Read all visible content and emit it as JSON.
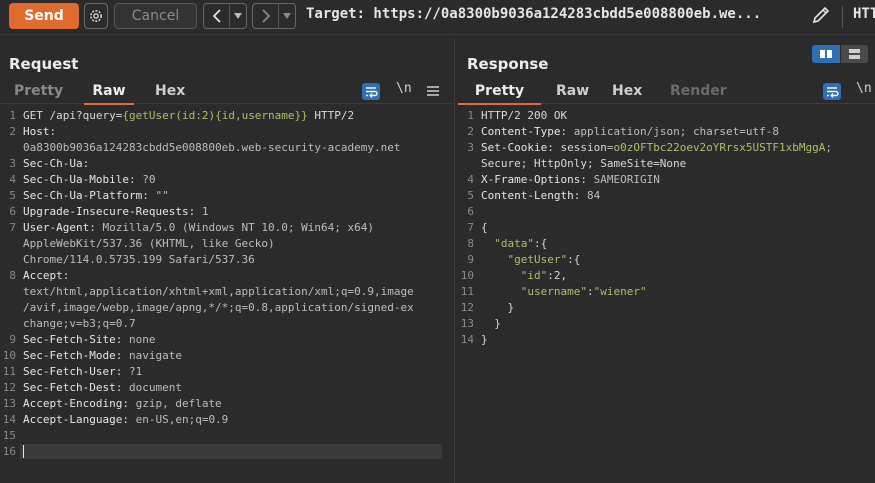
{
  "toolbar": {
    "send_label": "Send",
    "cancel_label": "Cancel",
    "back_label": "<",
    "forward_label": ">",
    "target_text": "Target: https://0a8300b9036a124283cbdd5e008800eb.we...",
    "overflow_text": "HTT"
  },
  "request": {
    "title": "Request",
    "tabs": [
      "Pretty",
      "Raw",
      "Hex"
    ],
    "active_tab": "Raw",
    "newline_toggle": "\\n",
    "lines": [
      {
        "n": "1",
        "text": "GET /api?query={getUser(id:2){id,username}} HTTP/2"
      },
      {
        "n": "2",
        "text": "Host:"
      },
      {
        "n": "",
        "text": "0a8300b9036a124283cbdd5e008800eb.web-security-academy.net"
      },
      {
        "n": "3",
        "text": "Sec-Ch-Ua:"
      },
      {
        "n": "4",
        "text": "Sec-Ch-Ua-Mobile: ?0"
      },
      {
        "n": "5",
        "text": "Sec-Ch-Ua-Platform: \"\""
      },
      {
        "n": "6",
        "text": "Upgrade-Insecure-Requests: 1"
      },
      {
        "n": "7",
        "text": "User-Agent: Mozilla/5.0 (Windows NT 10.0; Win64; x64)"
      },
      {
        "n": "",
        "text": "AppleWebKit/537.36 (KHTML, like Gecko)"
      },
      {
        "n": "",
        "text": "Chrome/114.0.5735.199 Safari/537.36"
      },
      {
        "n": "8",
        "text": "Accept:"
      },
      {
        "n": "",
        "text": "text/html,application/xhtml+xml,application/xml;q=0.9,image"
      },
      {
        "n": "",
        "text": "/avif,image/webp,image/apng,*/*;q=0.8,application/signed-ex"
      },
      {
        "n": "",
        "text": "change;v=b3;q=0.7"
      },
      {
        "n": "9",
        "text": "Sec-Fetch-Site: none"
      },
      {
        "n": "10",
        "text": "Sec-Fetch-Mode: navigate"
      },
      {
        "n": "11",
        "text": "Sec-Fetch-User: ?1"
      },
      {
        "n": "12",
        "text": "Sec-Fetch-Dest: document"
      },
      {
        "n": "13",
        "text": "Accept-Encoding: gzip, deflate"
      },
      {
        "n": "14",
        "text": "Accept-Language: en-US,en;q=0.9"
      },
      {
        "n": "15",
        "text": ""
      },
      {
        "n": "16",
        "text": ""
      }
    ]
  },
  "response": {
    "title": "Response",
    "tabs": [
      "Pretty",
      "Raw",
      "Hex",
      "Render"
    ],
    "active_tab": "Pretty",
    "newline_toggle": "\\n",
    "lines": [
      {
        "n": "1",
        "text": "HTTP/2 200 OK"
      },
      {
        "n": "2",
        "text": "Content-Type: application/json; charset=utf-8"
      },
      {
        "n": "3",
        "text": "Set-Cookie: session=o0zOFTbc22oev2oYRrsx5USTF1xbMggA;"
      },
      {
        "n": "",
        "text": "Secure; HttpOnly; SameSite=None"
      },
      {
        "n": "4",
        "text": "X-Frame-Options: SAMEORIGIN"
      },
      {
        "n": "5",
        "text": "Content-Length: 84"
      },
      {
        "n": "6",
        "text": ""
      },
      {
        "n": "7",
        "text": "{"
      },
      {
        "n": "8",
        "text": "  \"data\":{"
      },
      {
        "n": "9",
        "text": "    \"getUser\":{"
      },
      {
        "n": "10",
        "text": "      \"id\":2,"
      },
      {
        "n": "11",
        "text": "      \"username\":\"wiener\""
      },
      {
        "n": "12",
        "text": "    }"
      },
      {
        "n": "13",
        "text": "  }"
      },
      {
        "n": "14",
        "text": "}"
      }
    ]
  },
  "colors": {
    "accent": "#e06b2f",
    "blue": "#2f6fb3",
    "green": "#a8c26a"
  }
}
